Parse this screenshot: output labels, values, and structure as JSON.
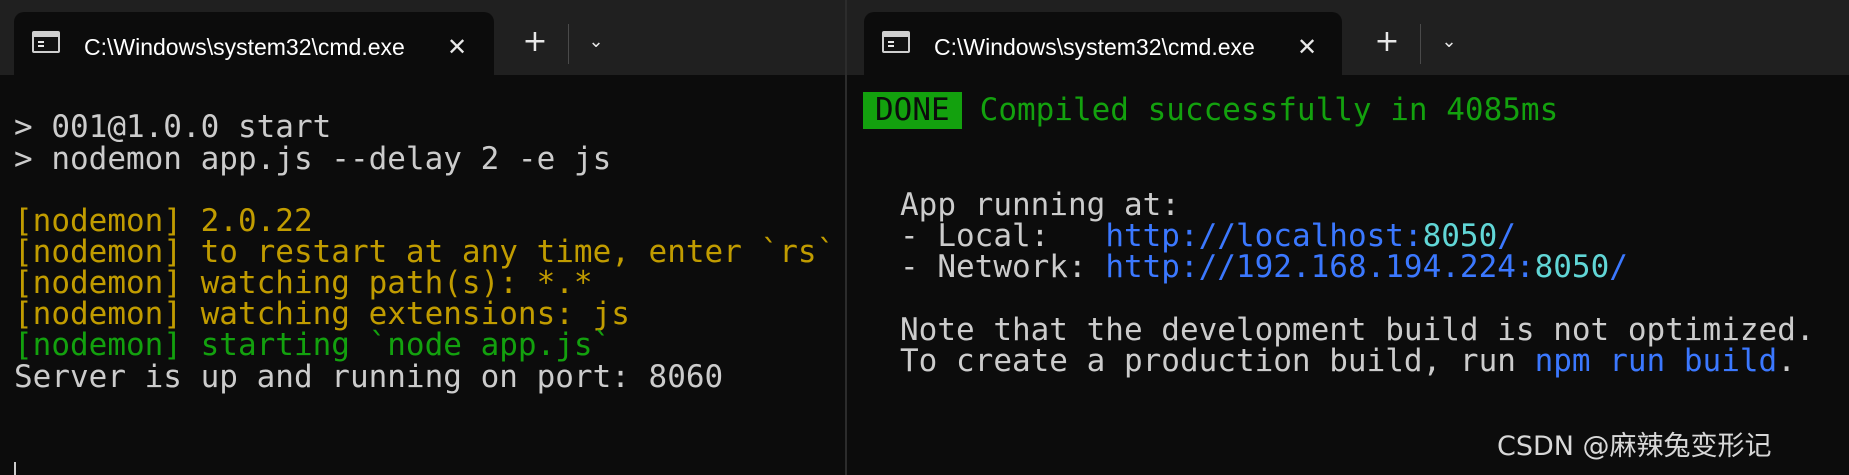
{
  "left": {
    "tab_title": "C:\\Windows\\system32\\cmd.exe",
    "close_glyph": "✕",
    "new_tab_glyph": "+",
    "dropdown_glyph": "⌄",
    "lines": [
      "> 001@1.0.0 start",
      "> nodemon app.js --delay 2 -e js",
      "[nodemon] 2.0.22",
      "[nodemon] to restart at any time, enter `rs`",
      "[nodemon] watching path(s): *.*",
      "[nodemon] watching extensions: js",
      "[nodemon] starting `node app.js`",
      "Server is up and running on port: 8060"
    ]
  },
  "right": {
    "tab_title": "C:\\Windows\\system32\\cmd.exe",
    "close_glyph": "✕",
    "new_tab_glyph": "+",
    "dropdown_glyph": "⌄",
    "done_badge": "DONE",
    "compiled_message": "Compiled successfully in 4085ms",
    "app_running": "App running at:",
    "local_label": "- Local:   ",
    "local_url_prefix": "http://localhost:",
    "local_port": "8050",
    "local_url_suffix": "/",
    "network_label": "- Network: ",
    "network_url_prefix": "http://192.168.194.224:",
    "network_port": "8050",
    "network_url_suffix": "/",
    "note_line": "Note that the development build is not optimized.",
    "create_prefix": "To create a production build, run ",
    "create_command": "npm run build",
    "create_suffix": "."
  },
  "watermark": "CSDN @麻辣兔变形记",
  "colors": {
    "background": "#0c0c0c",
    "tabbar": "#202020",
    "text": "#cccccc",
    "yellow": "#c19c00",
    "green": "#13a10e",
    "blue": "#3b78ff",
    "cyan": "#61d6d6"
  }
}
